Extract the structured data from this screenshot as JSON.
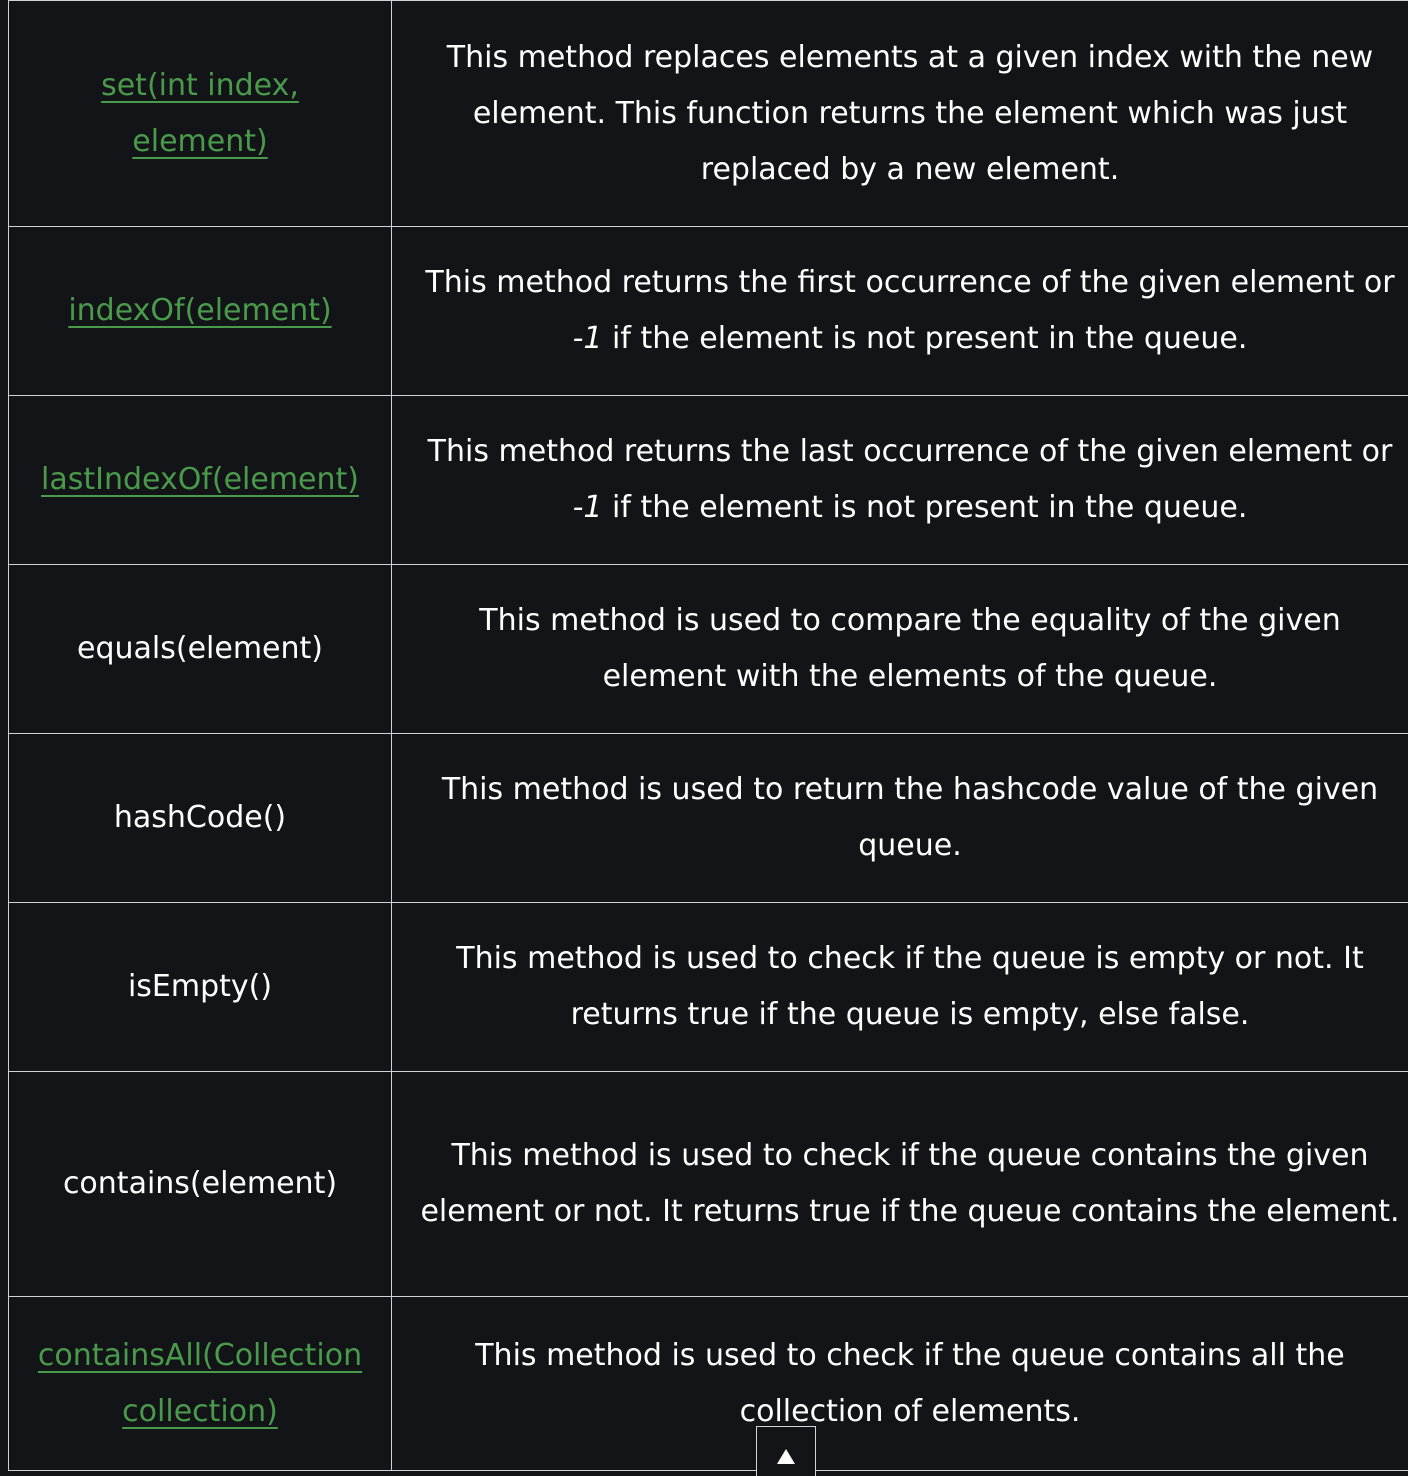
{
  "rows": [
    {
      "method": "set(int index, element)",
      "link": true,
      "description": [
        {
          "text": "This method replaces elements at a given index with the new element. This function returns the element which was just replaced by a new element.",
          "italic": false
        }
      ]
    },
    {
      "method": "indexOf(element)",
      "link": true,
      "description": [
        {
          "text": "This method returns the first occurrence of the given element or ",
          "italic": false
        },
        {
          "text": "-1",
          "italic": true
        },
        {
          "text": " if the element is not present in the queue.",
          "italic": false
        }
      ]
    },
    {
      "method": "lastIndexOf(element)",
      "link": true,
      "description": [
        {
          "text": "This method returns the last occurrence of the given element or ",
          "italic": false
        },
        {
          "text": "-1",
          "italic": true
        },
        {
          "text": " if the element is not present in the queue.",
          "italic": false
        }
      ]
    },
    {
      "method": "equals(element)",
      "link": false,
      "description": [
        {
          "text": "This method is used to compare the equality of the given element with the elements of the queue.",
          "italic": false
        }
      ]
    },
    {
      "method": "hashCode()",
      "link": false,
      "description": [
        {
          "text": "This method is used to return the hashcode value of the given queue.",
          "italic": false
        }
      ]
    },
    {
      "method": "isEmpty()",
      "link": false,
      "description": [
        {
          "text": "This method is used to check if the queue is empty or not. It returns true if the queue is empty, else false.",
          "italic": false
        }
      ]
    },
    {
      "method": "contains(element)",
      "link": false,
      "description": [
        {
          "text": "This method is used to check if the queue contains the given element or not. It returns true if the queue contains the element.",
          "italic": false
        }
      ]
    },
    {
      "method": "containsAll(Collection collection)",
      "link": true,
      "description": [
        {
          "text": "This method is used to check if the queue contains all the collection of elements.",
          "italic": false
        }
      ]
    }
  ],
  "scroll_to_top": {
    "icon": "up-arrow-icon"
  },
  "colors": {
    "background": "#131417",
    "text": "#ffffff",
    "link": "#4a9a4c",
    "border": "#cfd3d8"
  }
}
